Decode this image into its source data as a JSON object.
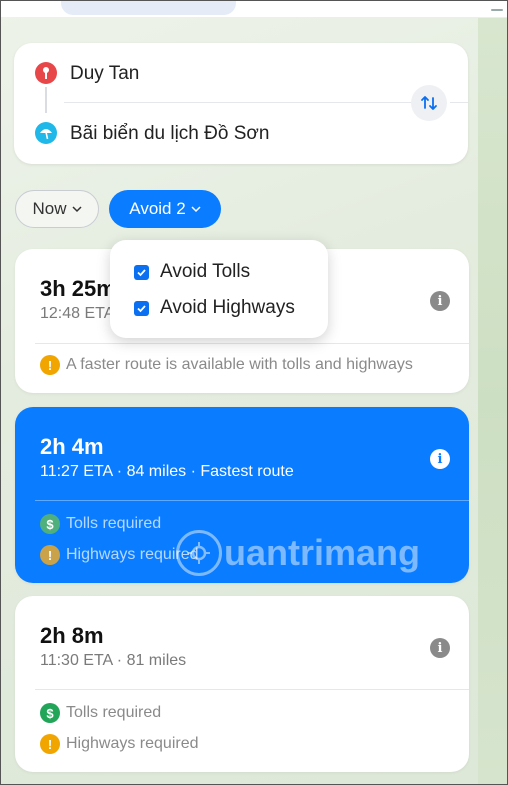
{
  "directions": {
    "from": "Duy Tan",
    "to": "Bãi biển du lịch Đồ Sơn"
  },
  "options": {
    "time_label": "Now",
    "avoid_label": "Avoid 2"
  },
  "avoid_menu": {
    "items": [
      {
        "label": "Avoid Tolls",
        "checked": true
      },
      {
        "label": "Avoid Highways",
        "checked": true
      }
    ]
  },
  "routes": [
    {
      "duration": "3h 25m",
      "eta": "12:48 ETA",
      "notes": [
        {
          "icon": "warning-icon",
          "text": "A faster route is available with tolls and highways"
        }
      ]
    },
    {
      "duration": "2h 4m",
      "eta": "11:27 ETA · 84 miles · Fastest route",
      "selected": true,
      "notes": [
        {
          "icon": "dollar-icon",
          "text": "Tolls required"
        },
        {
          "icon": "warning-icon",
          "text": "Highways required"
        }
      ]
    },
    {
      "duration": "2h 8m",
      "eta": "11:30 ETA · 81 miles",
      "notes": [
        {
          "icon": "dollar-icon",
          "text": "Tolls required"
        },
        {
          "icon": "warning-icon",
          "text": "Highways required"
        }
      ]
    }
  ],
  "watermark": {
    "text": "uantrimang"
  },
  "colors": {
    "accent": "#0a7cff",
    "pin_red": "#e8474a",
    "beach_blue": "#1fb8e8",
    "warning": "#f0a500",
    "toll_green": "#23a559"
  }
}
